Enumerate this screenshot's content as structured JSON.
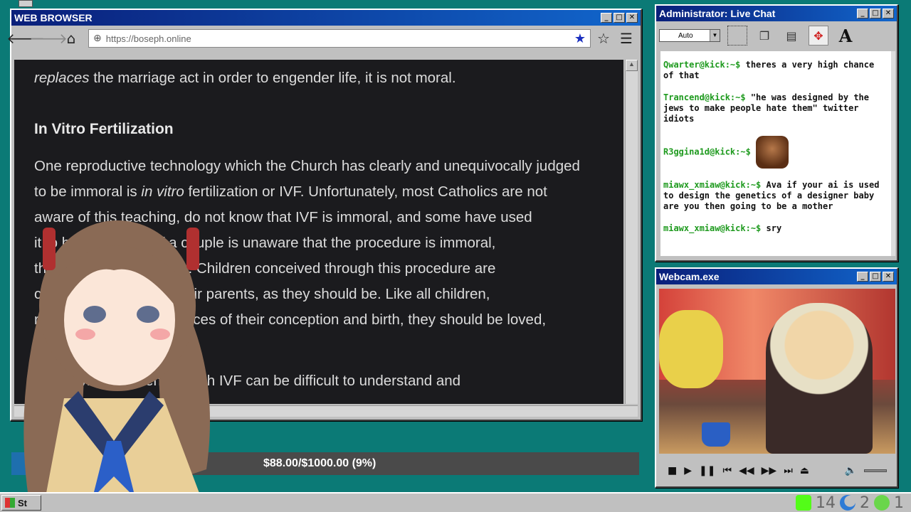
{
  "browser": {
    "title": "WEB BROWSER",
    "url": "https://boseph.online",
    "paragraphs": [
      "replaces the marriage act in order to engender life, it is not moral."
    ],
    "heading": "In Vitro Fertilization",
    "body_lines": [
      "One reproductive technology which the Church has clearly and unequivocally judged",
      "to be immoral is in vitro fertilization or IVF. Unfortunately, most Catholics are not",
      "aware of this teaching, do not know that IVF is immoral, and some have used",
      "it to have children. If a couple is unaware that the procedure is immoral,",
      "they are not guilty of sin. Children conceived through this procedure are",
      "created and loved by their parents, as they should be. Like all children,",
      "regardless of circumstances of their conception and birth, they should be loved,",
      "",
      "Conceiving children through IVF can be difficult to understand and"
    ]
  },
  "donation": {
    "text": "$88.00/$1000.00 (9%)",
    "progress_fraction": 0.088,
    "fill_color": "#1e6fae"
  },
  "chat": {
    "title": "Administrator: Live Chat",
    "font_select": "Auto",
    "messages": [
      {
        "user": "Qwarter@kick:~$",
        "text": "theres a very high chance of that"
      },
      {
        "user": "Trancend@kick:~$",
        "text": "\"he was designed by the jews to make people hate them\" twitter idiots"
      },
      {
        "user": "R3ggina1d@kick:~$",
        "text": ""
      },
      {
        "user": "miawx_xmiaw@kick:~$",
        "text": "Ava if your ai is used to design the genetics of a designer baby are you then going to be a mother"
      },
      {
        "user": "miawx_xmiaw@kick:~$",
        "text": "sry"
      }
    ],
    "username_color": "#1e9a1e"
  },
  "webcam": {
    "title": "Webcam.exe"
  },
  "taskbar": {
    "start_label": "St",
    "tray_numbers": [
      "14",
      "2",
      "1"
    ]
  }
}
